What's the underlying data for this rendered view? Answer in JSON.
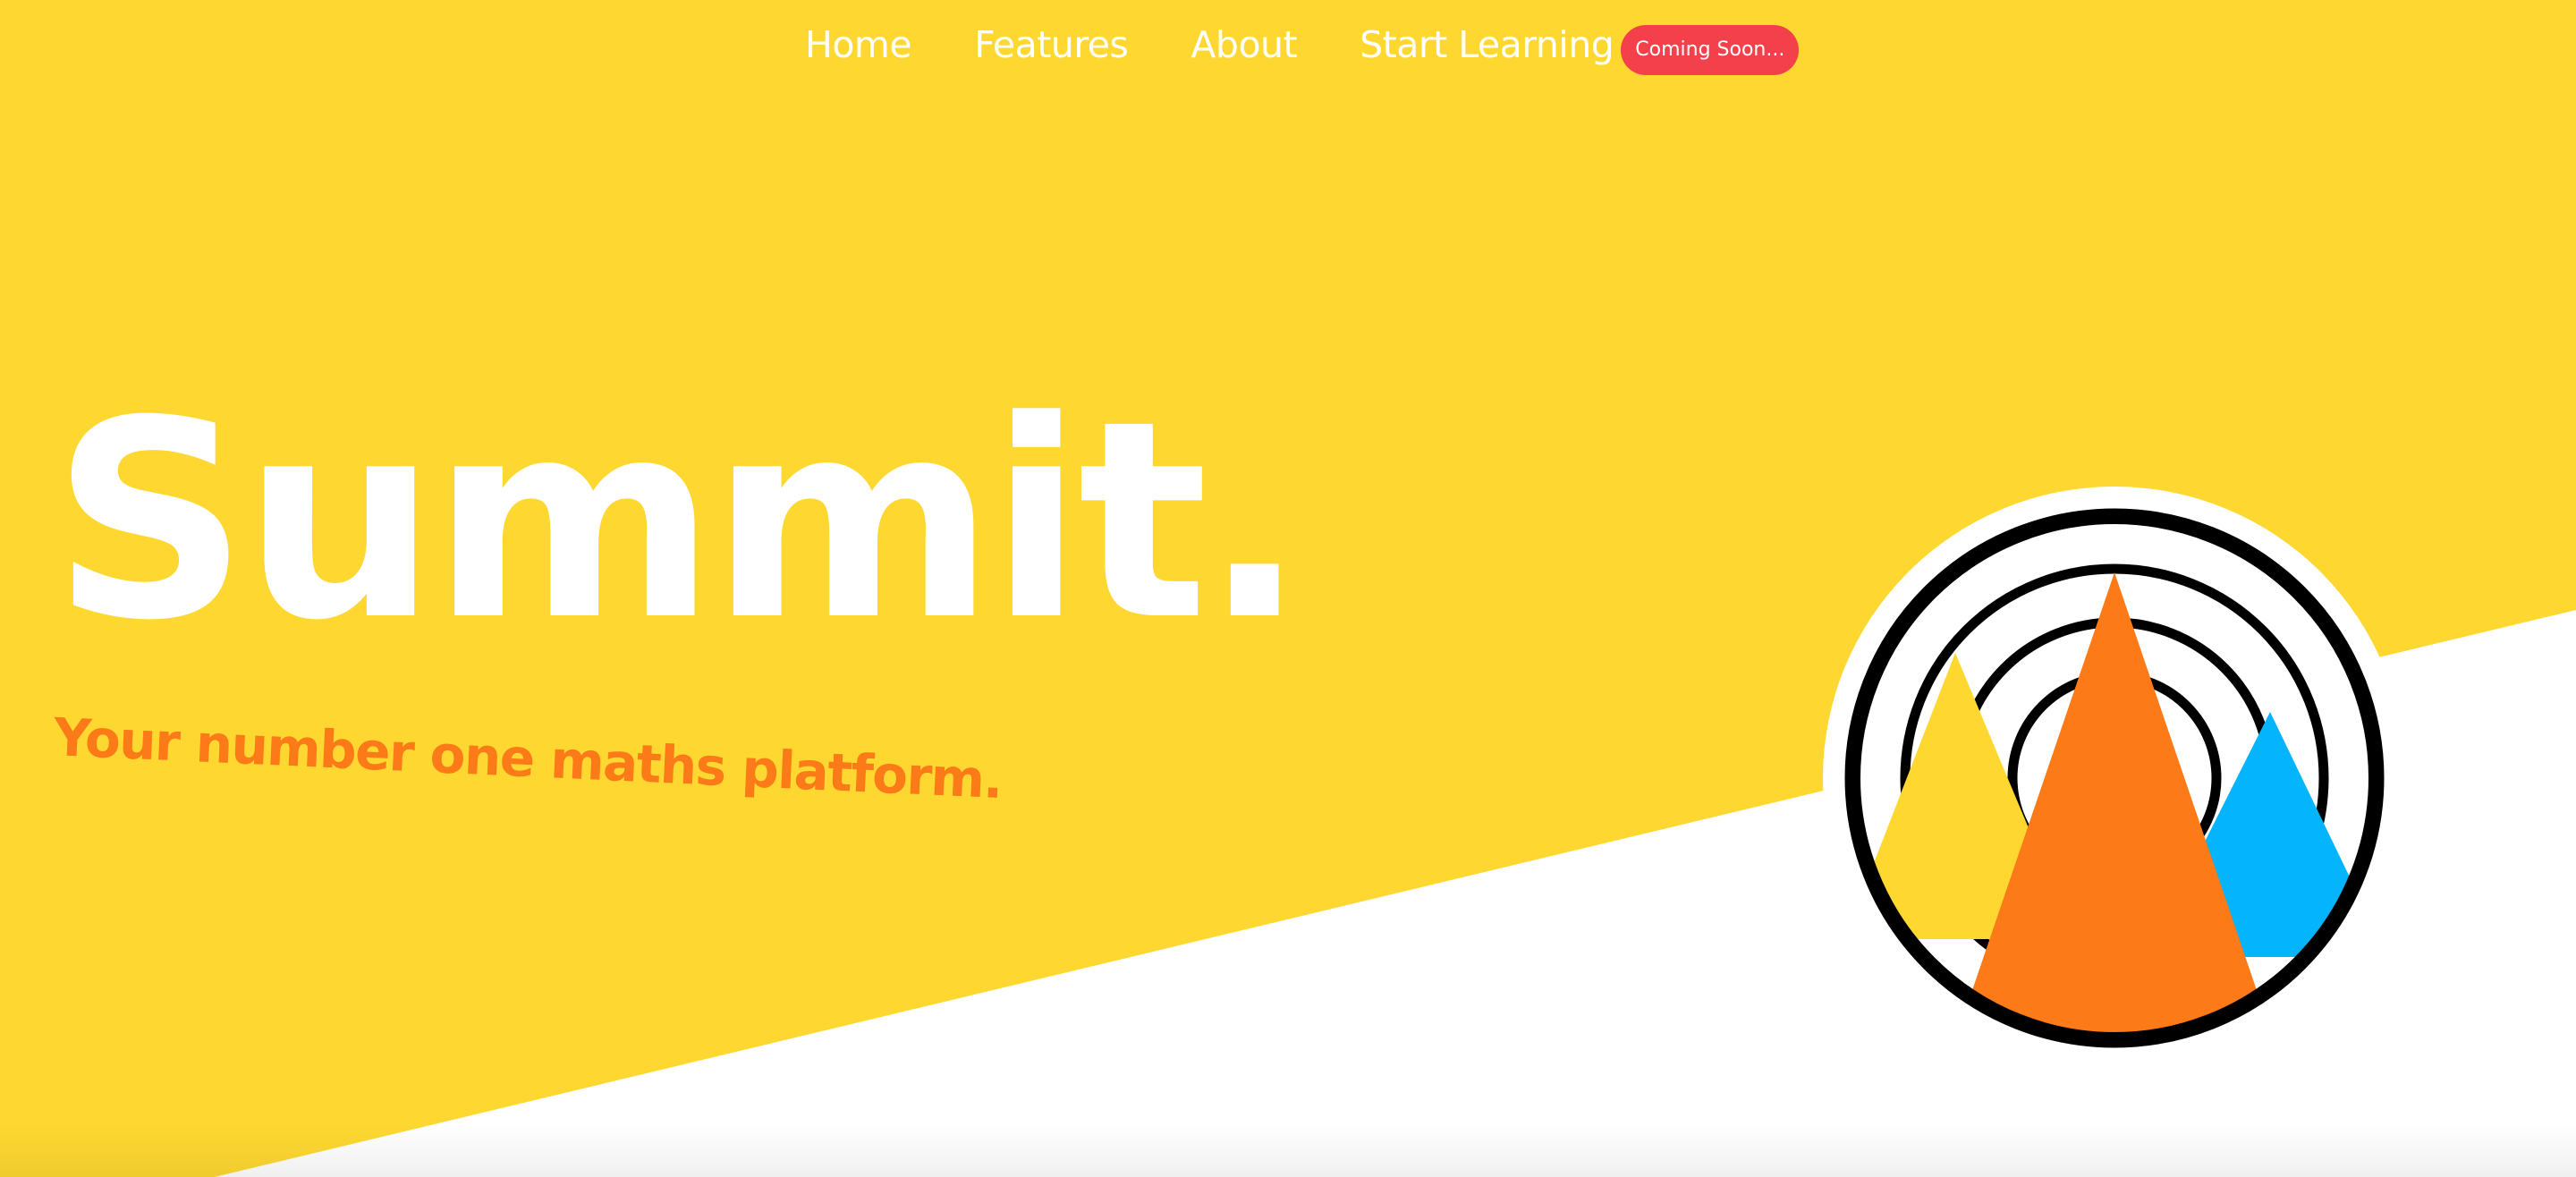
{
  "nav": {
    "links": [
      {
        "label": "Home"
      },
      {
        "label": "Features"
      },
      {
        "label": "About"
      },
      {
        "label": "Start Learning"
      }
    ],
    "badge": "Coming Soon..."
  },
  "hero": {
    "title": "Summit.",
    "tagline": "Your number one maths platform."
  },
  "colors": {
    "yellow": "#fed831",
    "orange": "#fc7a17",
    "blue": "#04b4fc",
    "badge_red": "#f4404b",
    "white": "#ffffff"
  },
  "icons": {
    "logo": "summit-mountain-logo-icon"
  }
}
